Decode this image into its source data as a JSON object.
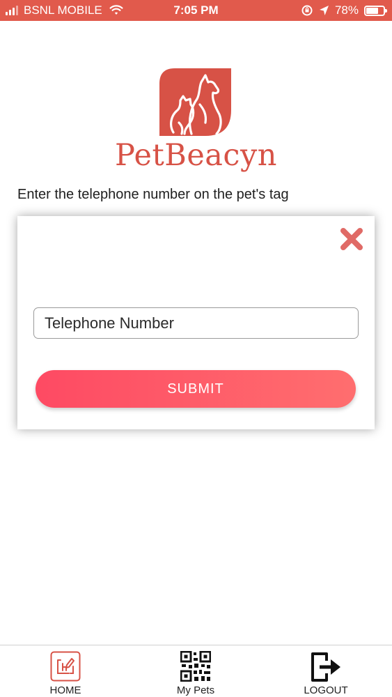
{
  "status_bar": {
    "carrier": "BSNL MOBILE",
    "time": "7:05 PM",
    "battery": "78%"
  },
  "brand": {
    "name": "PetBeacyn",
    "color": "#d75246"
  },
  "instruction": "Enter the telephone number on the pet's tag",
  "dialog": {
    "input_placeholder": "Telephone Number",
    "submit_label": "SUBMIT",
    "close_icon": "close-icon"
  },
  "tabs": [
    {
      "label": "HOME",
      "icon": "home-icon"
    },
    {
      "label": "My Pets",
      "icon": "qr-code-icon"
    },
    {
      "label": "LOGOUT",
      "icon": "logout-icon"
    }
  ],
  "colors": {
    "status_bar": "#e15a4c",
    "submit_start": "#fe4a63",
    "submit_end": "#ff6e6f",
    "close": "#e06a66"
  }
}
